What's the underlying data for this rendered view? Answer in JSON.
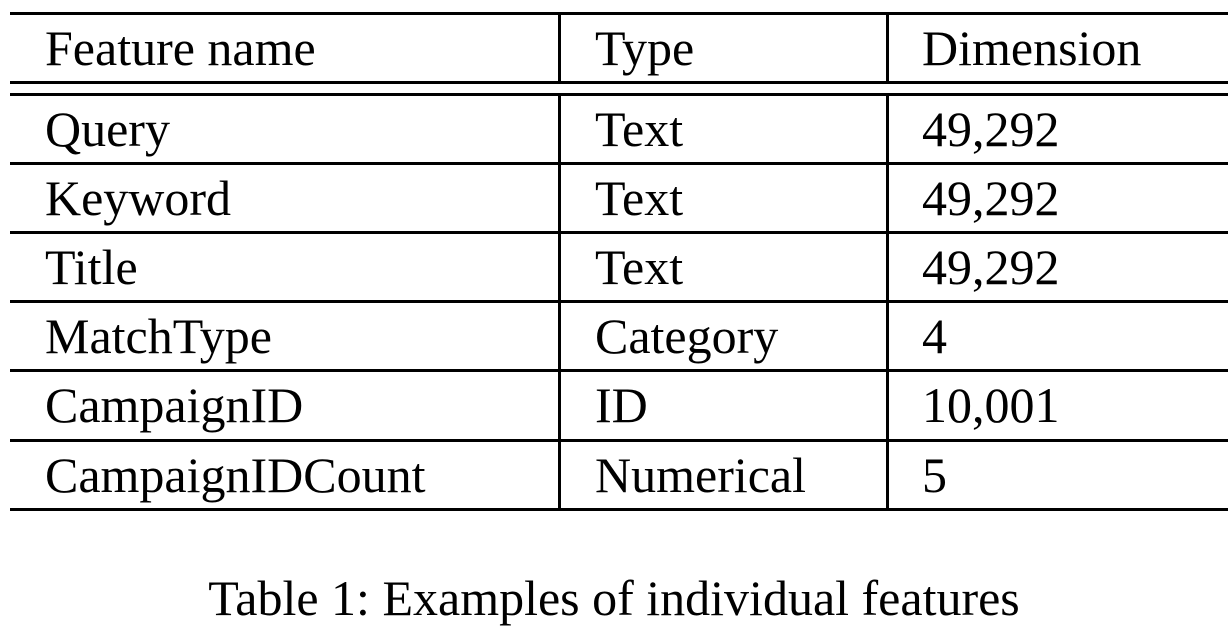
{
  "table": {
    "headers": [
      "Feature name",
      "Type",
      "Dimension"
    ],
    "rows": [
      [
        "Query",
        "Text",
        "49,292"
      ],
      [
        "Keyword",
        "Text",
        "49,292"
      ],
      [
        "Title",
        "Text",
        "49,292"
      ],
      [
        "MatchType",
        "Category",
        "4"
      ],
      [
        "CampaignID",
        "ID",
        "10,001"
      ],
      [
        "CampaignIDCount",
        "Numerical",
        "5"
      ]
    ]
  },
  "caption": "Table 1: Examples of individual features"
}
